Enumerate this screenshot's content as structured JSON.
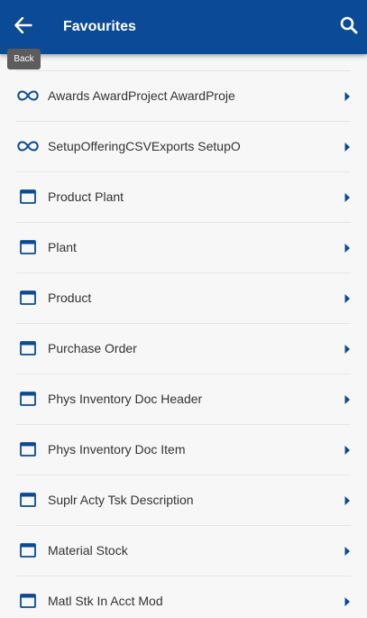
{
  "header": {
    "title": "Favourites",
    "back_icon": "arrow-left-icon",
    "search_icon": "search-icon",
    "background": "#0a4a96"
  },
  "tooltip": {
    "text": "Back"
  },
  "accent_color": "#0a4a96",
  "items": [
    {
      "label": "Awards AwardProject AwardProje",
      "icon": "link-icon"
    },
    {
      "label": "SetupOfferingCSVExports SetupO",
      "icon": "link-icon"
    },
    {
      "label": "Product Plant",
      "icon": "window-icon"
    },
    {
      "label": "Plant",
      "icon": "window-icon"
    },
    {
      "label": "Product",
      "icon": "window-icon"
    },
    {
      "label": "Purchase Order",
      "icon": "window-icon"
    },
    {
      "label": "Phys Inventory Doc Header",
      "icon": "window-icon"
    },
    {
      "label": "Phys Inventory Doc Item",
      "icon": "window-icon"
    },
    {
      "label": "Suplr Acty Tsk Description",
      "icon": "window-icon"
    },
    {
      "label": "Material Stock",
      "icon": "window-icon"
    },
    {
      "label": "Matl Stk In Acct Mod",
      "icon": "window-icon"
    }
  ]
}
